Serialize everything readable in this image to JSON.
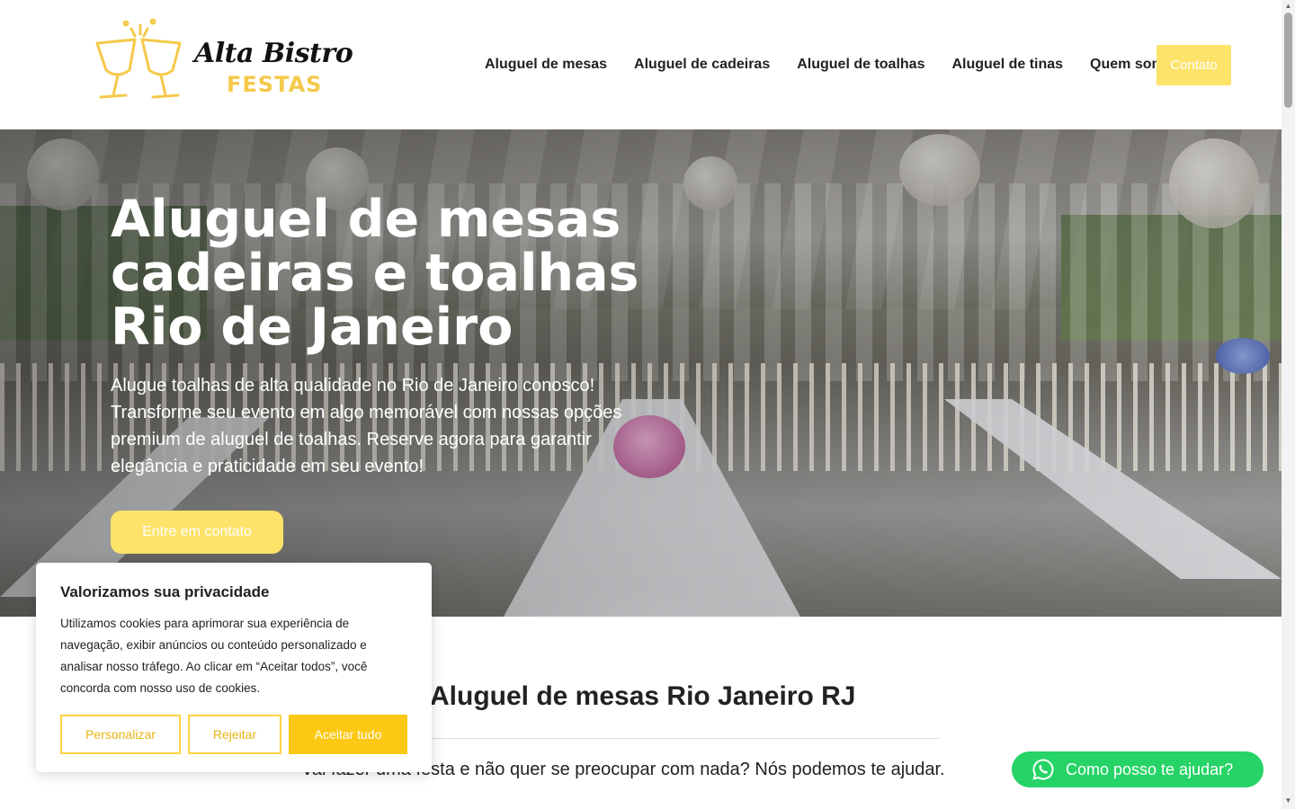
{
  "header": {
    "logo": {
      "line1": "Alta Bistro",
      "line2": "FESTAS",
      "icon": "champagne-glasses-icon"
    },
    "nav": [
      {
        "label": "Aluguel de mesas"
      },
      {
        "label": "Aluguel de cadeiras"
      },
      {
        "label": "Aluguel de toalhas"
      },
      {
        "label": "Aluguel de tinas"
      },
      {
        "label": "Quem somos"
      }
    ],
    "contact_label": "Contato"
  },
  "hero": {
    "title_lines": [
      "Aluguel de mesas",
      "cadeiras e toalhas",
      "Rio de Janeiro"
    ],
    "text": "Alugue toalhas de alta qualidade no Rio de Janeiro conosco! Transforme seu evento em algo memorável com nossas opções premium de aluguel de toalhas. Reserve agora para garantir elegância e praticidade em seu evento!",
    "cta_label": "Entre em contato"
  },
  "section": {
    "title": "Aluguel de mesas Rio Janeiro RJ",
    "text": "Vai fazer uma festa e não quer se preocupar com nada? Nós podemos te ajudar."
  },
  "cookie": {
    "title": "Valorizamos sua privacidade",
    "text": "Utilizamos cookies para aprimorar sua experiência de navegação, exibir anúncios ou conteúdo personalizado e analisar nosso tráfego. Ao clicar em “Aceitar todos”, você concorda com nosso uso de cookies.",
    "buttons": {
      "personalize": "Personalizar",
      "reject": "Rejeitar",
      "accept": "Aceitar tudo"
    }
  },
  "whatsapp": {
    "label": "Como posso te ajudar?",
    "icon": "whatsapp-icon"
  },
  "colors": {
    "accent": "#fde36a",
    "accent_strong": "#fcc814",
    "whatsapp": "#25d366"
  }
}
